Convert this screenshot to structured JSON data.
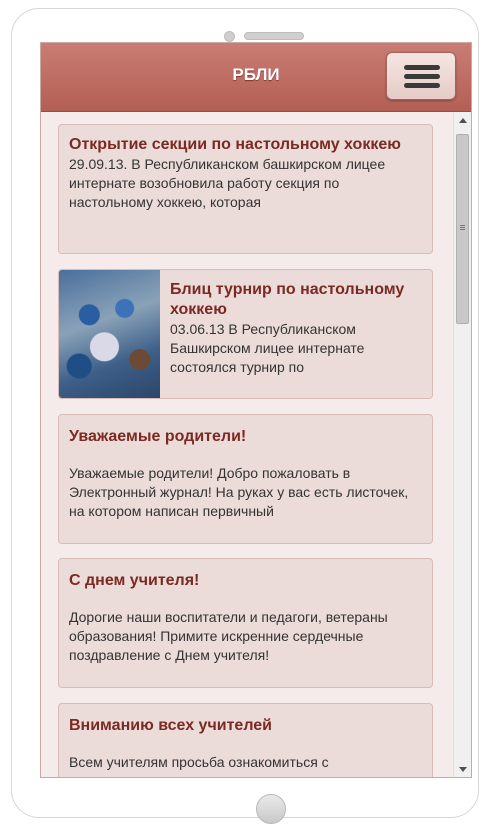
{
  "header": {
    "title": "РБЛИ",
    "menu_icon": "hamburger-icon"
  },
  "cards": [
    {
      "title": "Открытие секции по настольному хоккею",
      "text": "29.09.13. В Республиканском башкирском лицее интернате возобновила работу секция по настольному хоккею, которая"
    },
    {
      "title": "Блиц турнир по настольному хоккею",
      "text": "03.06.13 В Республиканском Башкирском лицее интернате состоялся турнир по",
      "has_image": true
    },
    {
      "title": "Уважаемые родители!",
      "text": "Уважаемые родители! Добро пожаловать в Электронный журнал! На руках у вас есть листочек, на котором написан первичный"
    },
    {
      "title": "С днем учителя!",
      "text": "Дорогие наши воспитатели и педагоги, ветераны образования! Примите искренние сердечные поздравление с Днем учителя!"
    },
    {
      "title": "Вниманию всех учителей",
      "text": "Всем учителям просьба ознакомиться с"
    }
  ],
  "colors": {
    "header": "#b45f55",
    "card_bg": "#ecdcd9",
    "title_text": "#7a2a22",
    "screen_bg": "#f5ebea"
  }
}
